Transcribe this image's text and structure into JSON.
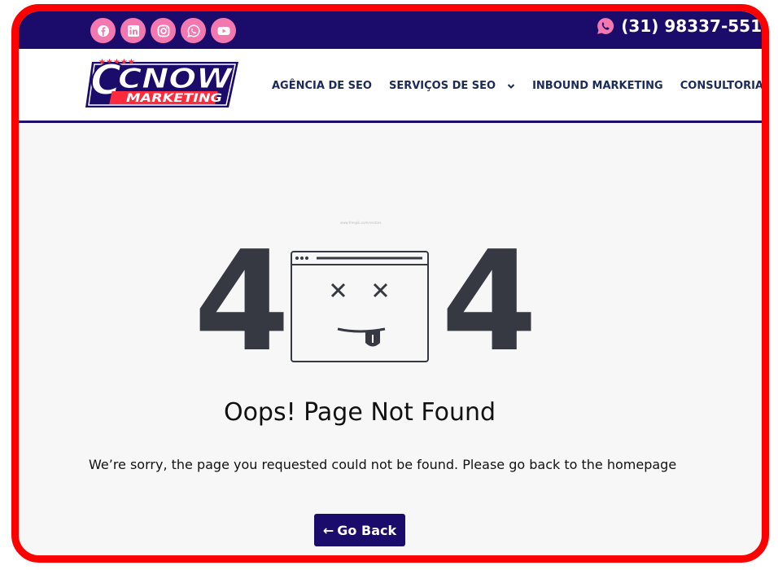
{
  "topbar": {
    "social_icons": [
      "facebook-icon",
      "linkedin-icon",
      "instagram-icon",
      "whatsapp-icon",
      "youtube-icon"
    ],
    "phone": "(31) 98337-551"
  },
  "logo": {
    "line1": "CNOW",
    "line2": "MARKETING"
  },
  "nav": {
    "items": [
      {
        "label": "AGÊNCIA DE SEO"
      },
      {
        "label": "SERVIÇOS DE SEO"
      },
      {
        "label": "INBOUND MARKETING"
      },
      {
        "label": "CONSULTORIA COMERC"
      }
    ]
  },
  "error": {
    "digit_left": "4",
    "digit_right": "4",
    "tiny_text": "www.freepik.com/vectors",
    "title": "Oops! Page Not Found",
    "message": "We’re sorry, the page you requested could not be found. Please go back to the homepage",
    "button_arrow": "←",
    "button_label": "Go Back"
  },
  "colors": {
    "frame": "#ff0000",
    "navy": "#1b0c6b",
    "pink": "#f478b0",
    "page_bg": "#f7f7f7",
    "digit": "#363842"
  }
}
